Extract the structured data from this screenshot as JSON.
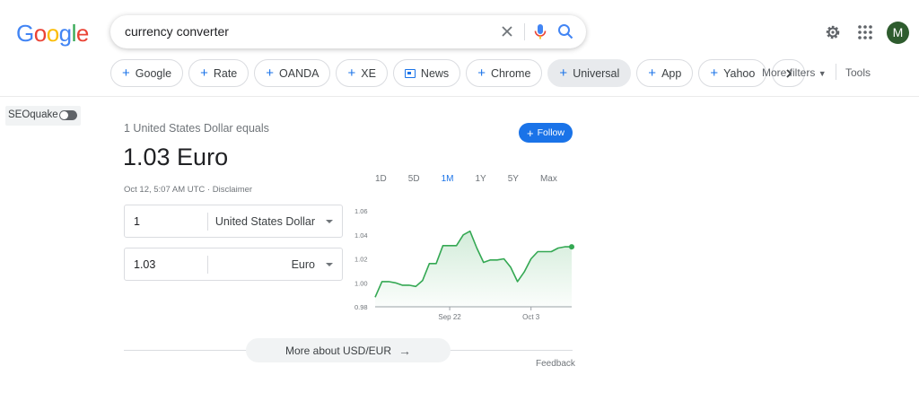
{
  "logo": {
    "letters": [
      "G",
      "o",
      "o",
      "g",
      "l",
      "e"
    ],
    "colors": [
      "#4285F4",
      "#EA4335",
      "#FBBC05",
      "#4285F4",
      "#34A853",
      "#EA4335"
    ]
  },
  "search": {
    "query": "currency converter",
    "clear_icon": "close-icon",
    "mic_icon": "mic-icon",
    "search_icon": "search-icon"
  },
  "header": {
    "avatar_letter": "M",
    "settings_icon": "gear-icon",
    "apps_icon": "apps-grid-icon"
  },
  "chips": [
    {
      "label": "Google",
      "kind": "plus"
    },
    {
      "label": "Rate",
      "kind": "plus"
    },
    {
      "label": "OANDA",
      "kind": "plus"
    },
    {
      "label": "XE",
      "kind": "plus"
    },
    {
      "label": "News",
      "kind": "news"
    },
    {
      "label": "Chrome",
      "kind": "plus"
    },
    {
      "label": "Universal",
      "kind": "plus",
      "active": true
    },
    {
      "label": "App",
      "kind": "plus"
    },
    {
      "label": "Yahoo",
      "kind": "plus"
    }
  ],
  "filters": {
    "more_filters": "More filters",
    "tools": "Tools"
  },
  "seoquake": {
    "label": "SEOquake"
  },
  "converter": {
    "equals": "1 United States Dollar equals",
    "result": "1.03 Euro",
    "timestamp": "Oct 12, 5:07 AM UTC · Disclaimer",
    "follow": "Follow",
    "from_amount": "1",
    "from_currency": "United States Dollar",
    "to_amount": "1.03",
    "to_currency": "Euro"
  },
  "ranges": {
    "items": [
      "1D",
      "5D",
      "1M",
      "1Y",
      "5Y",
      "Max"
    ],
    "selected": "1M"
  },
  "chart_data": {
    "type": "line",
    "ylim": [
      0.98,
      1.06
    ],
    "yticks": [
      "1.06",
      "1.04",
      "1.02",
      "1.00",
      "0.98"
    ],
    "xtick_labels": [
      "Sep 22",
      "Oct 3"
    ],
    "xtick_index": [
      11,
      23
    ],
    "line_color": "#34A853",
    "values": [
      0.988,
      1.001,
      1.001,
      1.0,
      0.998,
      0.998,
      0.997,
      1.002,
      1.016,
      1.016,
      1.031,
      1.031,
      1.031,
      1.04,
      1.043,
      1.029,
      1.017,
      1.019,
      1.019,
      1.02,
      1.013,
      1.001,
      1.009,
      1.02,
      1.026,
      1.026,
      1.026,
      1.029,
      1.03,
      1.03
    ]
  },
  "more_about": "More about USD/EUR",
  "feedback": "Feedback"
}
